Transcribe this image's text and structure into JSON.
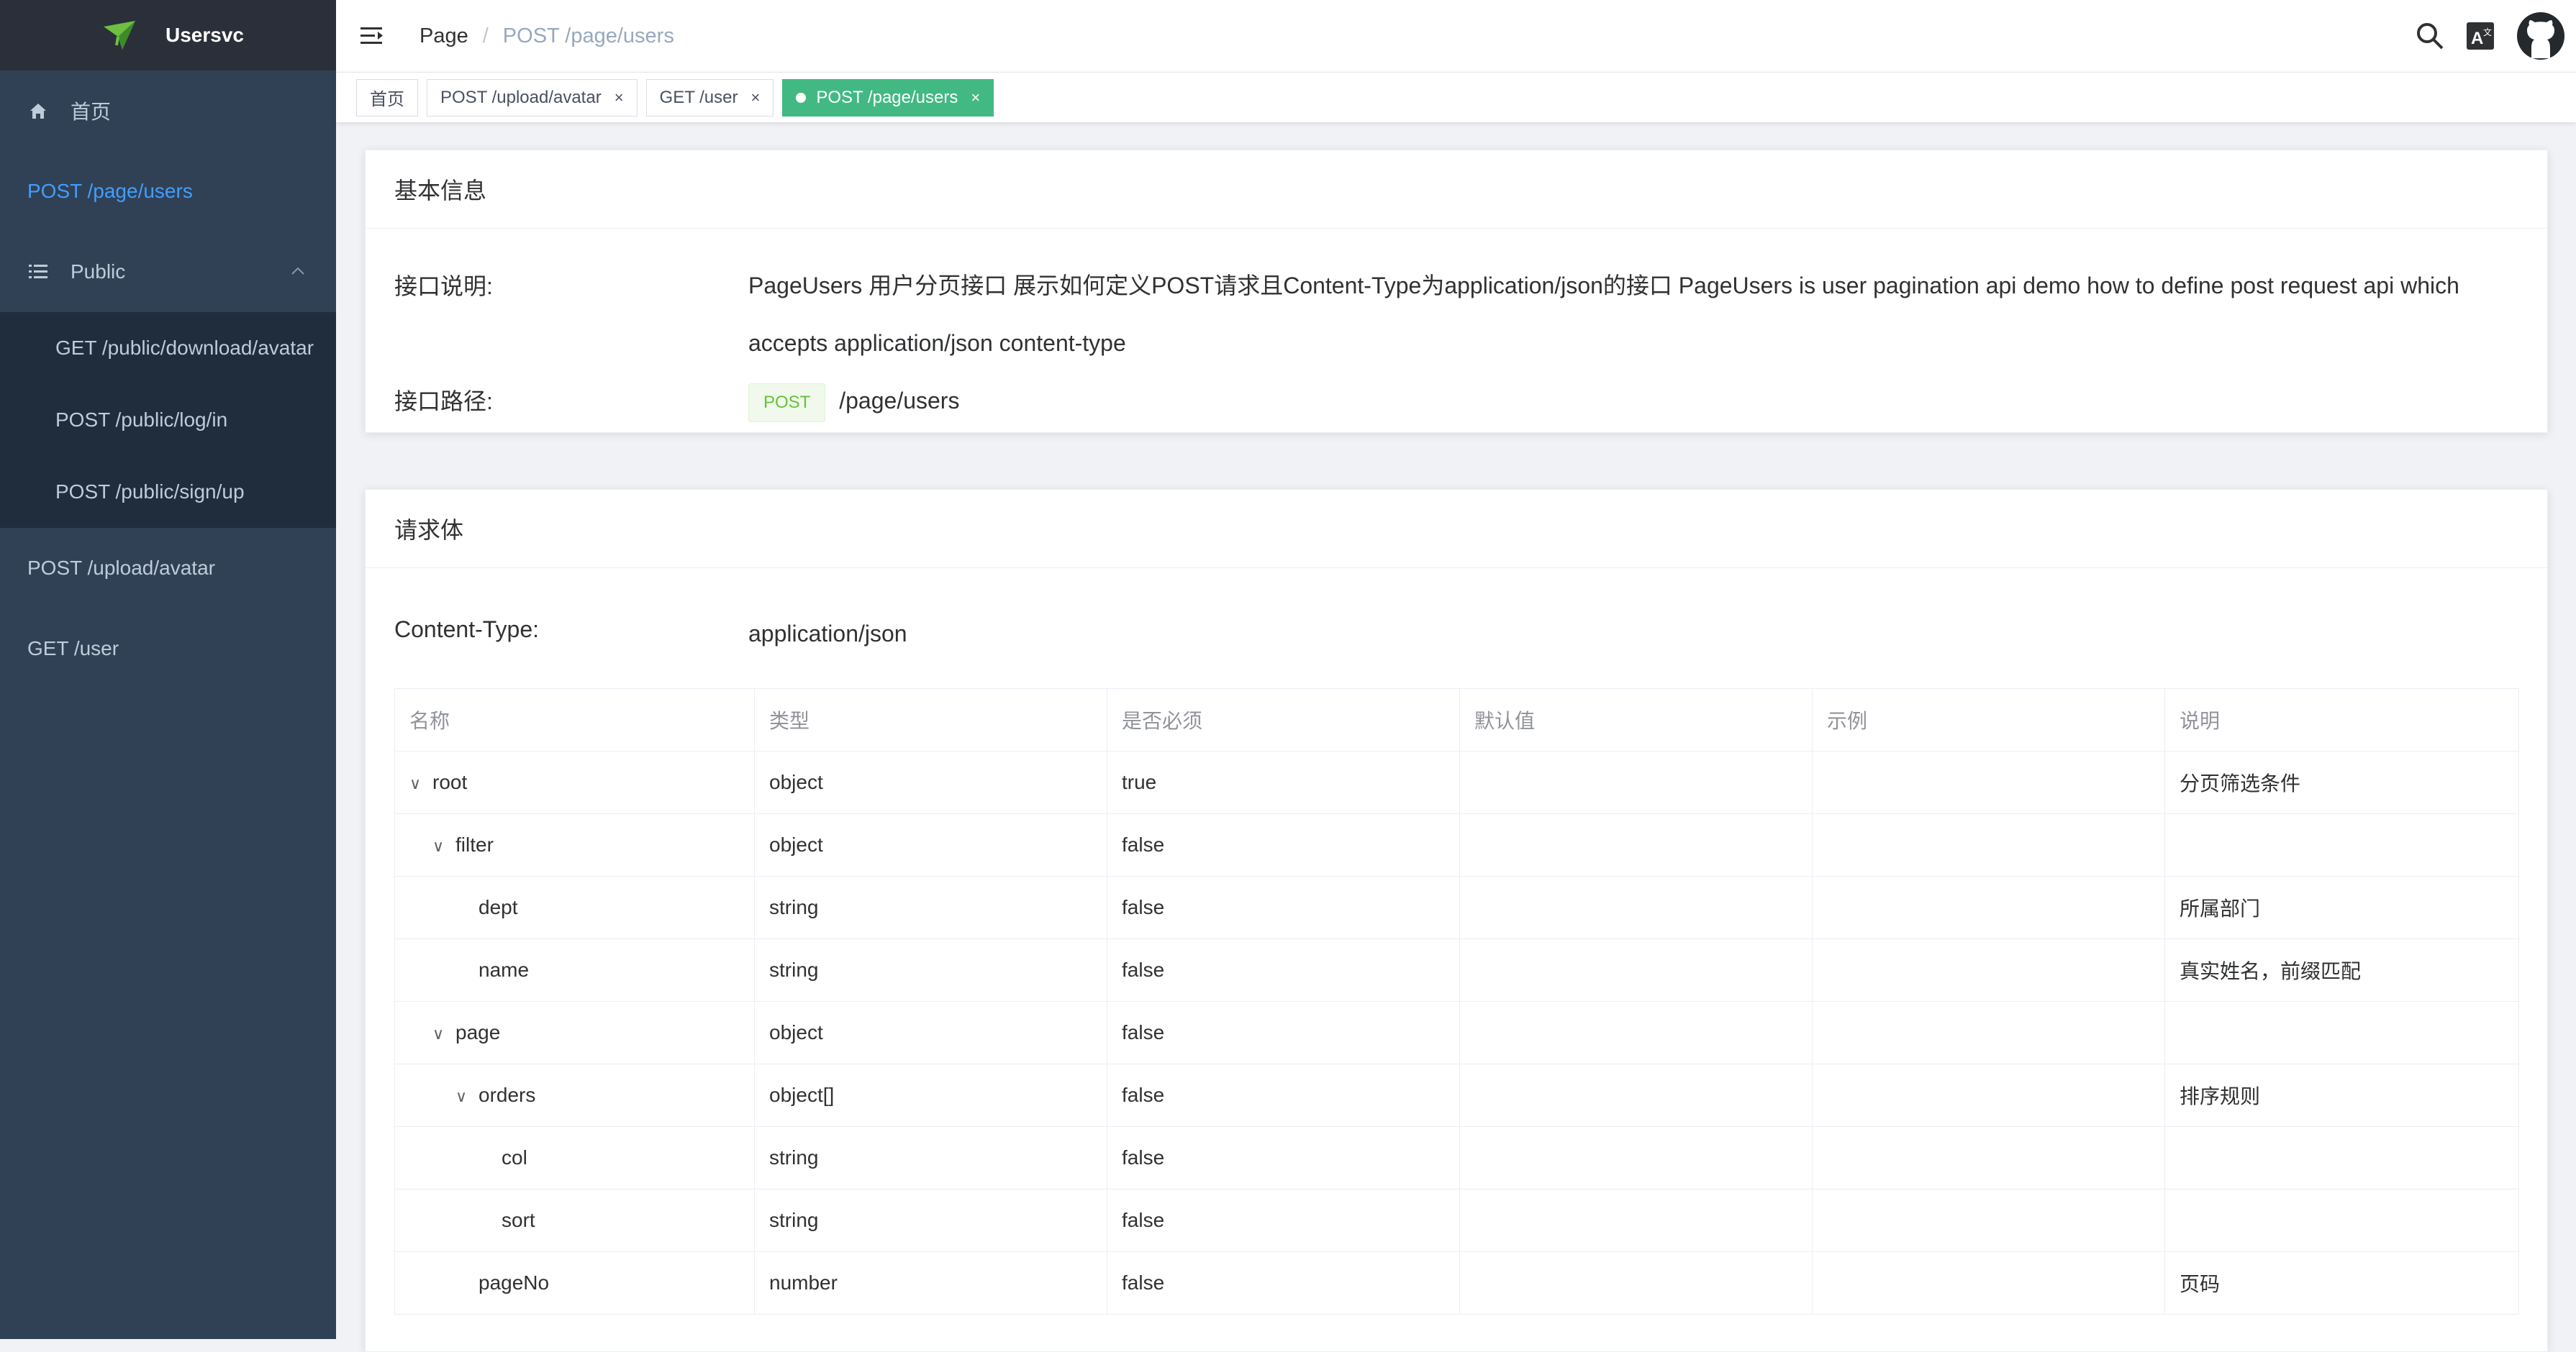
{
  "app": {
    "title": "Usersvc"
  },
  "sidebar": {
    "items": [
      {
        "label": "首页",
        "icon": "home-icon"
      },
      {
        "label": "POST /page/users",
        "active": true
      },
      {
        "label": "Public",
        "icon": "list-icon",
        "expanded": true,
        "children": [
          {
            "label": "GET /public/download/avatar"
          },
          {
            "label": "POST /public/log/in"
          },
          {
            "label": "POST /public/sign/up"
          }
        ]
      },
      {
        "label": "POST /upload/avatar"
      },
      {
        "label": "GET /user"
      }
    ]
  },
  "header": {
    "breadcrumb": [
      "Page",
      "/",
      "POST /page/users"
    ],
    "icons": [
      "search-icon",
      "translate-icon",
      "github-icon"
    ]
  },
  "tags": [
    {
      "label": "首页"
    },
    {
      "label": "POST /upload/avatar",
      "close": "×"
    },
    {
      "label": "GET /user",
      "close": "×"
    },
    {
      "label": "POST /page/users",
      "close": "×",
      "active": true
    }
  ],
  "basic_info": {
    "title": "基本信息",
    "desc_label": "接口说明:",
    "desc_line1": "PageUsers 用户分页接口 展示如何定义POST请求且Content-Type为application/json的接口 PageUsers is user pagination api demo how to define post request api which",
    "desc_line2": "accepts application/json content-type",
    "path_label": "接口路径:",
    "method": "POST",
    "path": "/page/users"
  },
  "request_body": {
    "title": "请求体",
    "content_type_label": "Content-Type:",
    "content_type": "application/json",
    "columns": [
      "名称",
      "类型",
      "是否必须",
      "默认值",
      "示例",
      "说明"
    ],
    "rows": [
      {
        "name": "root",
        "type": "object",
        "required": "true",
        "default": "",
        "example": "",
        "desc": "分页筛选条件",
        "caret": "∨",
        "level": 0
      },
      {
        "name": "filter",
        "type": "object",
        "required": "false",
        "default": "",
        "example": "",
        "desc": "",
        "caret": "∨",
        "level": 1
      },
      {
        "name": "dept",
        "type": "string",
        "required": "false",
        "default": "",
        "example": "",
        "desc": "所属部门",
        "caret": "",
        "level": 2
      },
      {
        "name": "name",
        "type": "string",
        "required": "false",
        "default": "",
        "example": "",
        "desc": "真实姓名，前缀匹配",
        "caret": "",
        "level": 2
      },
      {
        "name": "page",
        "type": "object",
        "required": "false",
        "default": "",
        "example": "",
        "desc": "",
        "caret": "∨",
        "level": 1
      },
      {
        "name": "orders",
        "type": "object[]",
        "required": "false",
        "default": "",
        "example": "",
        "desc": "排序规则",
        "caret": "∨",
        "level": 2
      },
      {
        "name": "col",
        "type": "string",
        "required": "false",
        "default": "",
        "example": "",
        "desc": "",
        "caret": "",
        "level": 3
      },
      {
        "name": "sort",
        "type": "string",
        "required": "false",
        "default": "",
        "example": "",
        "desc": "",
        "caret": "",
        "level": 3
      },
      {
        "name": "pageNo",
        "type": "number",
        "required": "false",
        "default": "",
        "example": "",
        "desc": "页码",
        "caret": "",
        "level": 2
      }
    ]
  }
}
